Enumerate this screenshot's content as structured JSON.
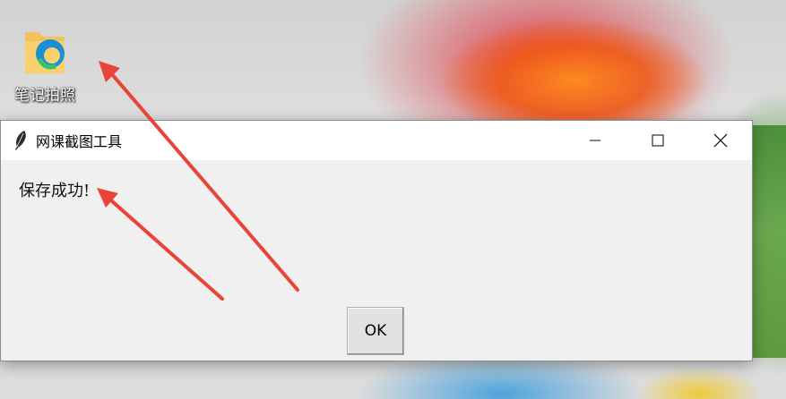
{
  "desktop": {
    "icon": {
      "name": "folder-edge-icon",
      "label": "笔记拍照"
    }
  },
  "dialog": {
    "title": "网课截图工具",
    "app_icon": "feather-icon",
    "controls": [
      "minimize-icon",
      "maximize-icon",
      "close-icon"
    ],
    "message": "保存成功!",
    "ok_label": "OK"
  },
  "colors": {
    "annotation_arrow": "#e8443a",
    "dialog_bg": "#f0f0f0",
    "titlebar_bg": "#ffffff"
  }
}
